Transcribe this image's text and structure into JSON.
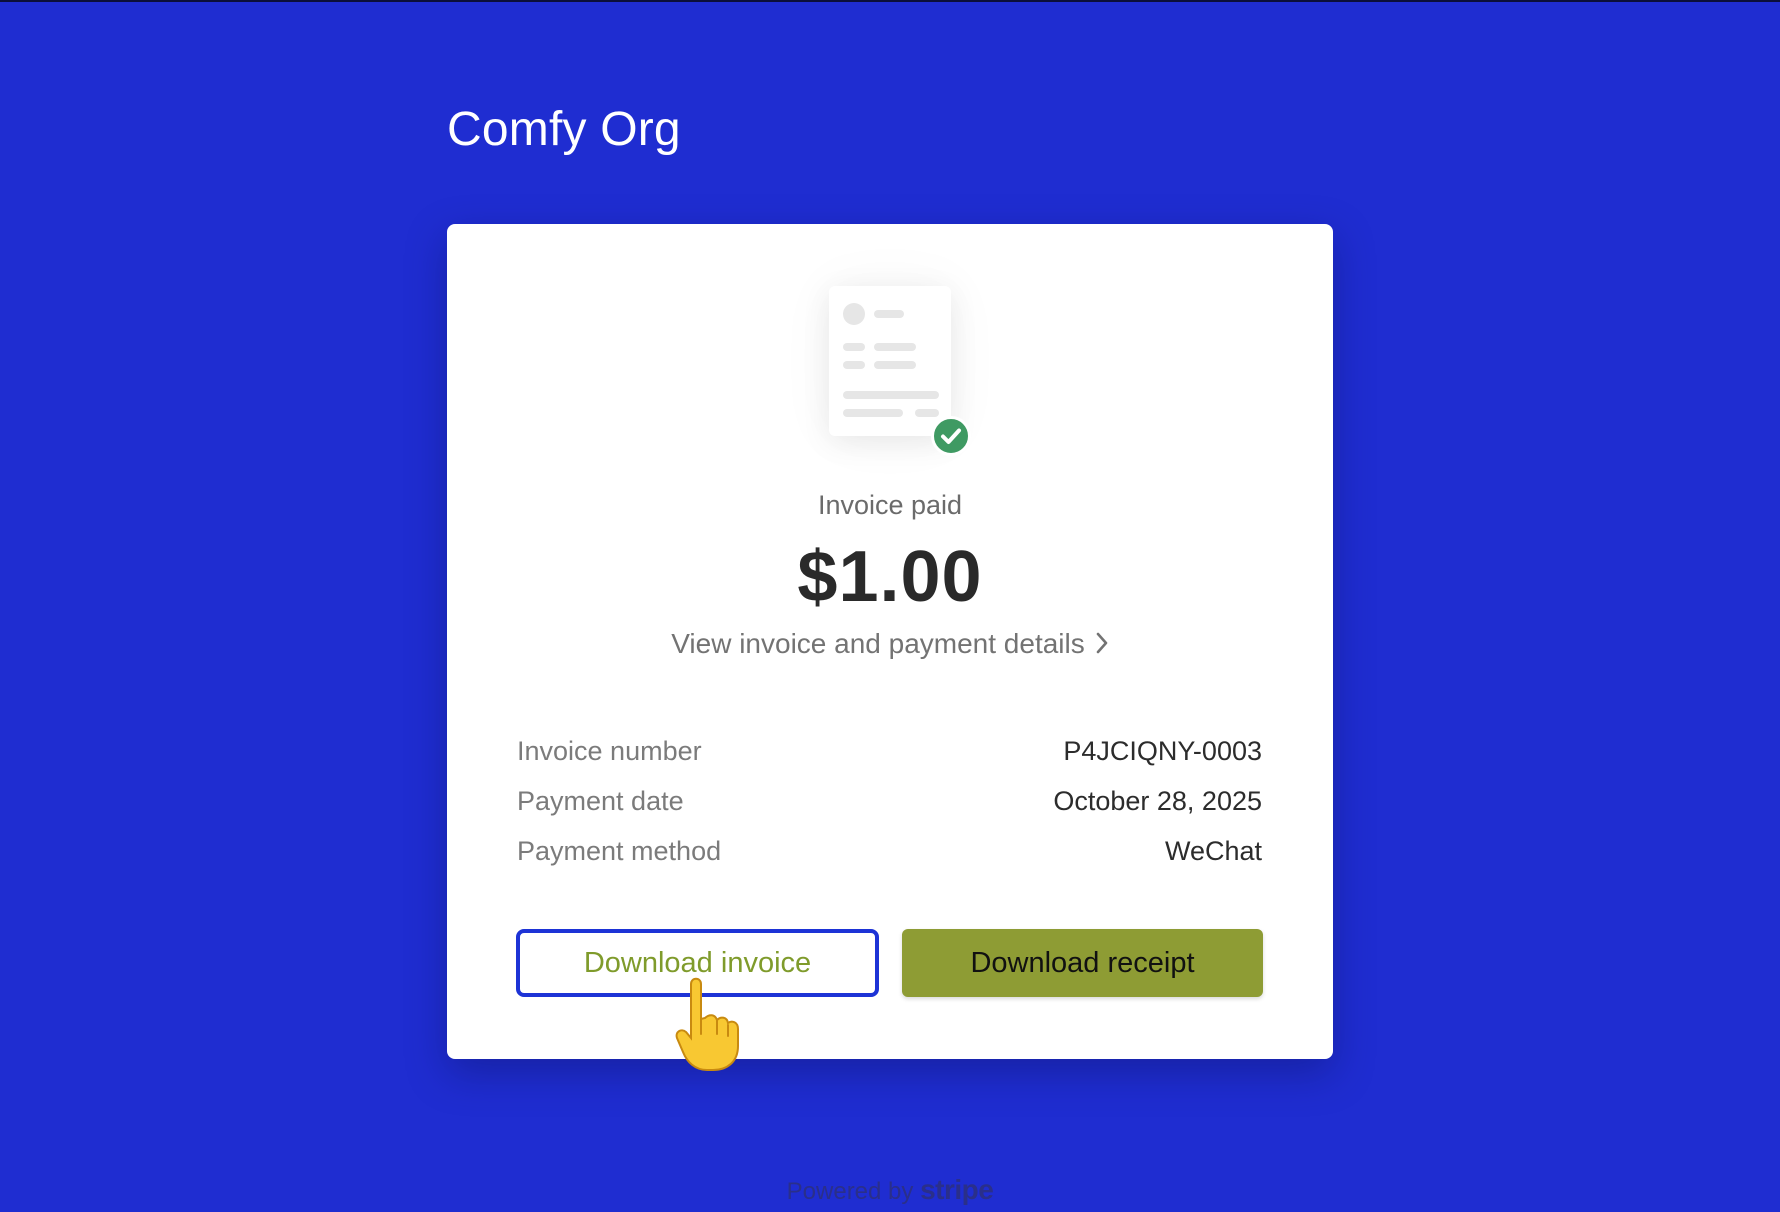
{
  "org": {
    "name": "Comfy Org"
  },
  "invoice": {
    "status": "Invoice paid",
    "amount": "$1.00",
    "details_link": "View invoice and payment details",
    "rows": [
      {
        "label": "Invoice number",
        "value": "P4JCIQNY-0003"
      },
      {
        "label": "Payment date",
        "value": "October 28, 2025"
      },
      {
        "label": "Payment method",
        "value": "WeChat"
      }
    ]
  },
  "buttons": {
    "download_invoice": "Download invoice",
    "download_receipt": "Download receipt"
  },
  "footer": {
    "powered_by": "Powered by",
    "brand": "stripe"
  },
  "colors": {
    "background": "#1f2dd1",
    "check": "#3f9a63",
    "receipt_button": "#8e9c34",
    "invoice_button_text": "#7f9b2b",
    "focus_ring": "#1d33d6"
  },
  "icons": {
    "invoice_illustration": "invoice-document-icon",
    "paid_check": "check-circle-icon",
    "chevron": "chevron-right-icon",
    "cursor": "pointing-hand-cursor"
  }
}
